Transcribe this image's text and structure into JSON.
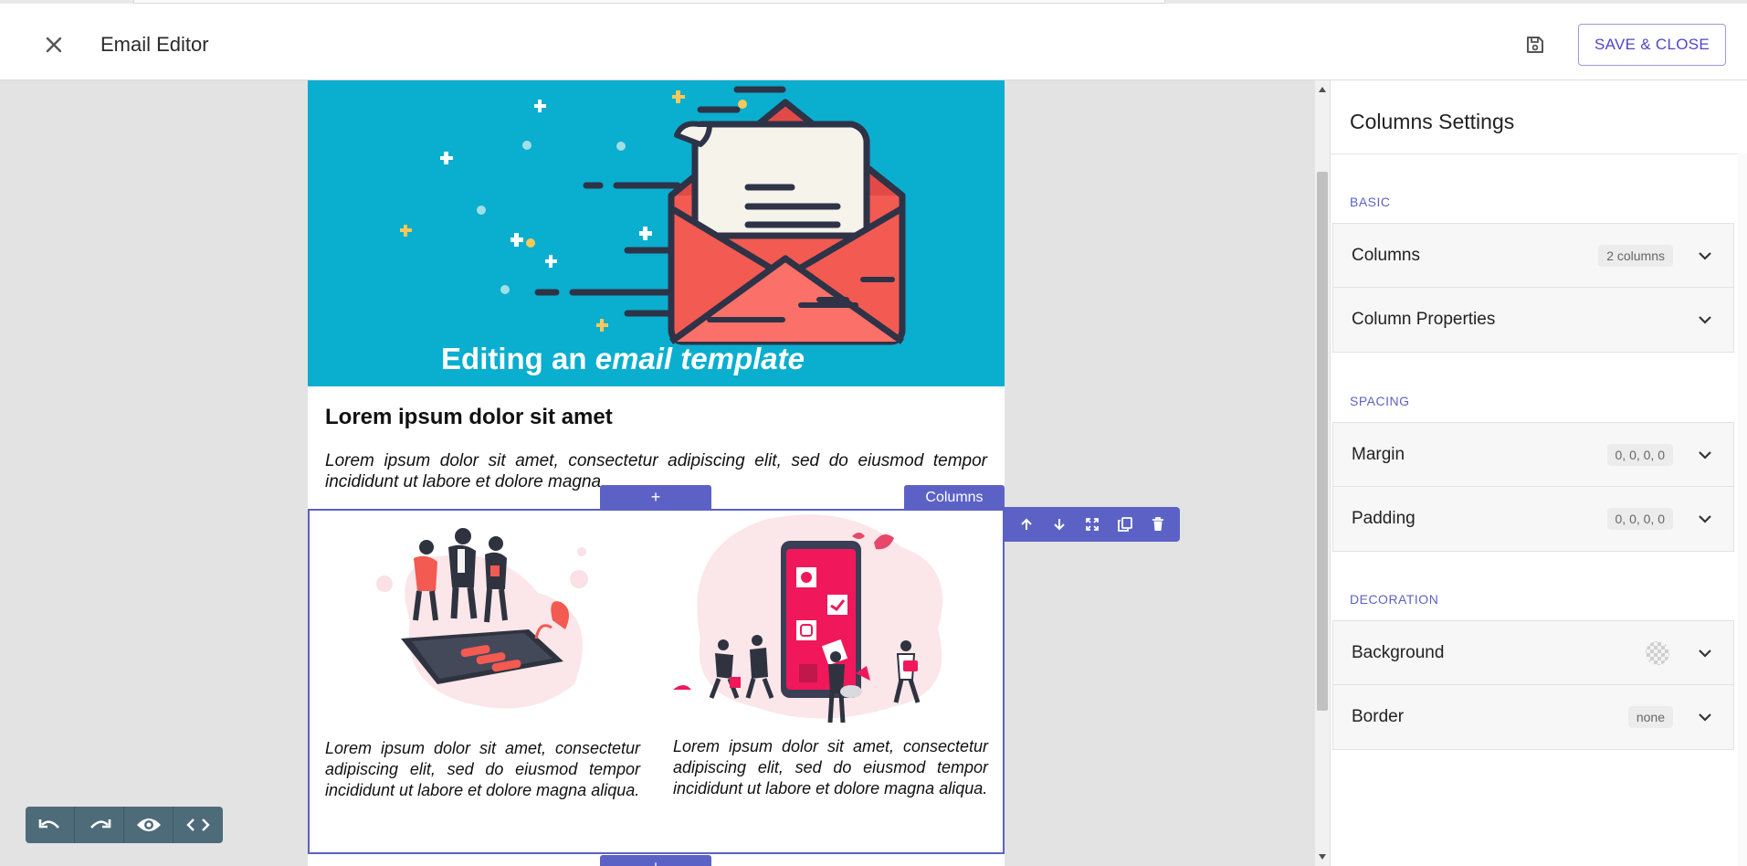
{
  "app": {
    "title": "Email Editor",
    "close_icon": "close-icon",
    "save_icon": "floppy-disk-icon",
    "save_close_label": "SAVE & CLOSE",
    "accent_color": "#5c62c5"
  },
  "email": {
    "hero": {
      "text_plain": "Editing an ",
      "text_italic": "email template",
      "background": "#0aaecf"
    },
    "heading": "Lorem ipsum dolor sit amet",
    "paragraph": "Lorem ipsum dolor sit amet, consectetur adipiscing elit, sed do eiusmod tempor incididunt ut labore et dolore magna",
    "add_row_label": "+",
    "selected_row": {
      "tag": "Columns",
      "left_text": "Lorem ipsum dolor sit amet, consectetur adipiscing elit, sed do eiusmod tempor incididunt ut labore et dolore magna aliqua.",
      "right_text": "Lorem ipsum dolor sit amet, consectetur adipiscing elit, sed do eiusmod tempor incididunt ut labore et dolore magna aliqua."
    },
    "row_tools": [
      "arrow-up-icon",
      "arrow-down-icon",
      "expand-icon",
      "duplicate-icon",
      "trash-icon"
    ]
  },
  "history": [
    "undo-icon",
    "redo-icon",
    "eye-icon",
    "code-icon"
  ],
  "panel": {
    "title": "Columns Settings",
    "sections": {
      "basic": {
        "label": "BASIC",
        "items": [
          {
            "label": "Columns",
            "badge": "2 columns"
          },
          {
            "label": "Column Properties",
            "badge": ""
          }
        ]
      },
      "spacing": {
        "label": "SPACING",
        "items": [
          {
            "label": "Margin",
            "badge": "0, 0, 0, 0"
          },
          {
            "label": "Padding",
            "badge": "0, 0, 0, 0"
          }
        ]
      },
      "decoration": {
        "label": "DECORATION",
        "items": [
          {
            "label": "Background",
            "badge": ""
          },
          {
            "label": "Border",
            "badge": "none"
          }
        ]
      }
    }
  }
}
